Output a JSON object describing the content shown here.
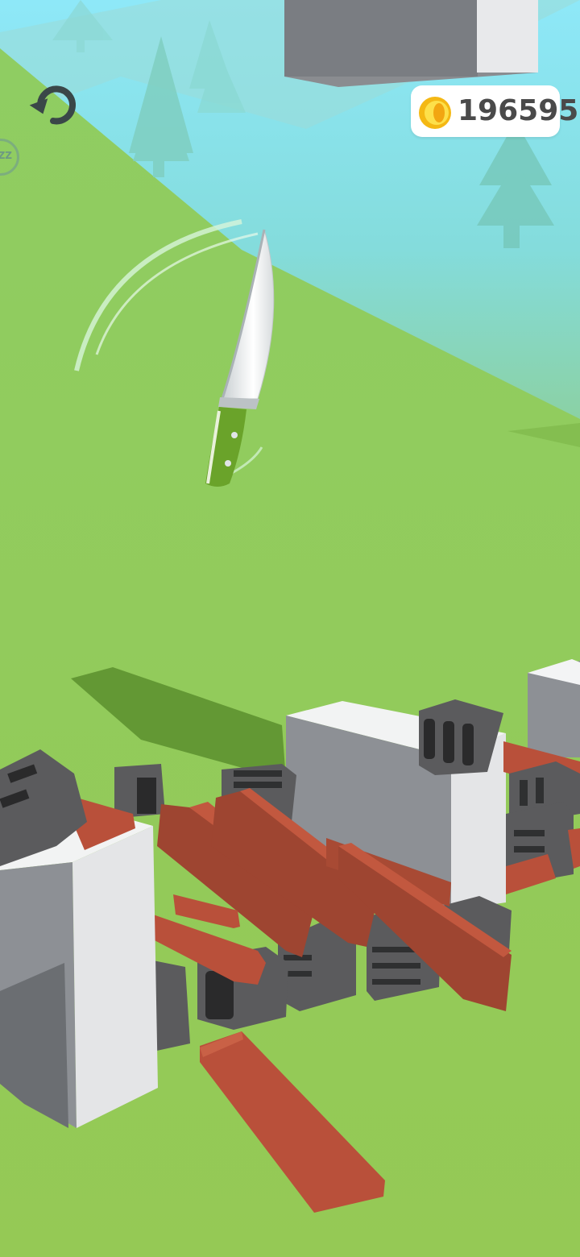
{
  "hud": {
    "coin_count": "196595",
    "side_button_label": "ZZ",
    "restart_icon": "restart-icon",
    "coin_icon": "coin-icon"
  },
  "colors": {
    "sky_top": "#8ee6f6",
    "sky_bottom": "#7fd8d0",
    "ground": "#93c955",
    "knife_handle": "#6aa32a",
    "knife_blade": "#e8e8e8",
    "plank": "#b9503a",
    "cinder_block": "#5b5b5d",
    "concrete": "#e6e6e8",
    "coin": "#f4b814"
  }
}
